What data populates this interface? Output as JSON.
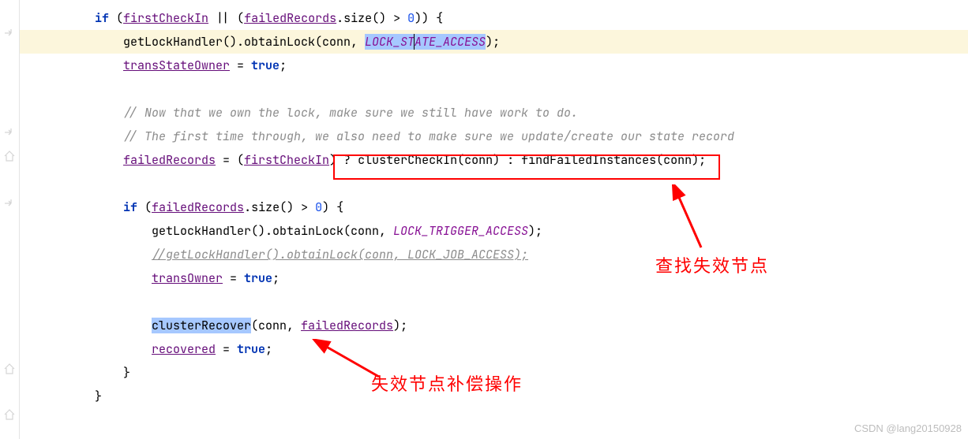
{
  "code": {
    "l1": {
      "t1": "if",
      "t2": " (",
      "t3": "firstCheckIn",
      "t4": " || (",
      "t5": "failedRecords",
      "t6": ".size() > ",
      "t7": "0",
      "t8": ")) {"
    },
    "l2": {
      "t1": "    getLockHandler().obtainLock(conn, ",
      "t2": "LOCK_ST",
      "t3": "A",
      "t4": "TE_ACCESS",
      "t5": ");"
    },
    "l3": {
      "t1": "    ",
      "t2": "transStateOwner",
      "t3": " = ",
      "t4": "true",
      "t5": ";"
    },
    "l4": {
      "t1": ""
    },
    "l5": {
      "t1": "    ",
      "t2": "// Now that we own the lock, make sure we still have work to do."
    },
    "l6": {
      "t1": "    ",
      "t2": "// The first time through, we also need to make sure we update/create our state record"
    },
    "l7": {
      "t1": "    ",
      "t2": "failedRecords",
      "t3": " = (",
      "t4": "firstCheckIn",
      "t5": ") ? clusterCheckIn(conn) : findFailedInstances(conn);"
    },
    "l8": {
      "t1": ""
    },
    "l9": {
      "t1": "    ",
      "t2": "if",
      "t3": " (",
      "t4": "failedRecords",
      "t5": ".size() > ",
      "t6": "0",
      "t7": ") {"
    },
    "l10": {
      "t1": "        getLockHandler().obtainLock(conn, ",
      "t2": "LOCK_TRIGGER_ACCESS",
      "t3": ");"
    },
    "l11": {
      "t1": "        ",
      "t2": "//getLockHandler().obtainLock(conn, LOCK_JOB_ACCESS);"
    },
    "l12": {
      "t1": "        ",
      "t2": "transOwner",
      "t3": " = ",
      "t4": "true",
      "t5": ";"
    },
    "l13": {
      "t1": ""
    },
    "l14": {
      "t1": "        ",
      "t2": "clusterRecover",
      "t3": "(conn, ",
      "t4": "failedRecords",
      "t5": ");"
    },
    "l15": {
      "t1": "        ",
      "t2": "recovered",
      "t3": " = ",
      "t4": "true",
      "t5": ";"
    },
    "l16": {
      "t1": "    }"
    },
    "l17": {
      "t1": "}"
    }
  },
  "annotations": {
    "ann1": "查找失效节点",
    "ann2": "失效节点补偿操作"
  },
  "watermark": "CSDN @lang20150928"
}
